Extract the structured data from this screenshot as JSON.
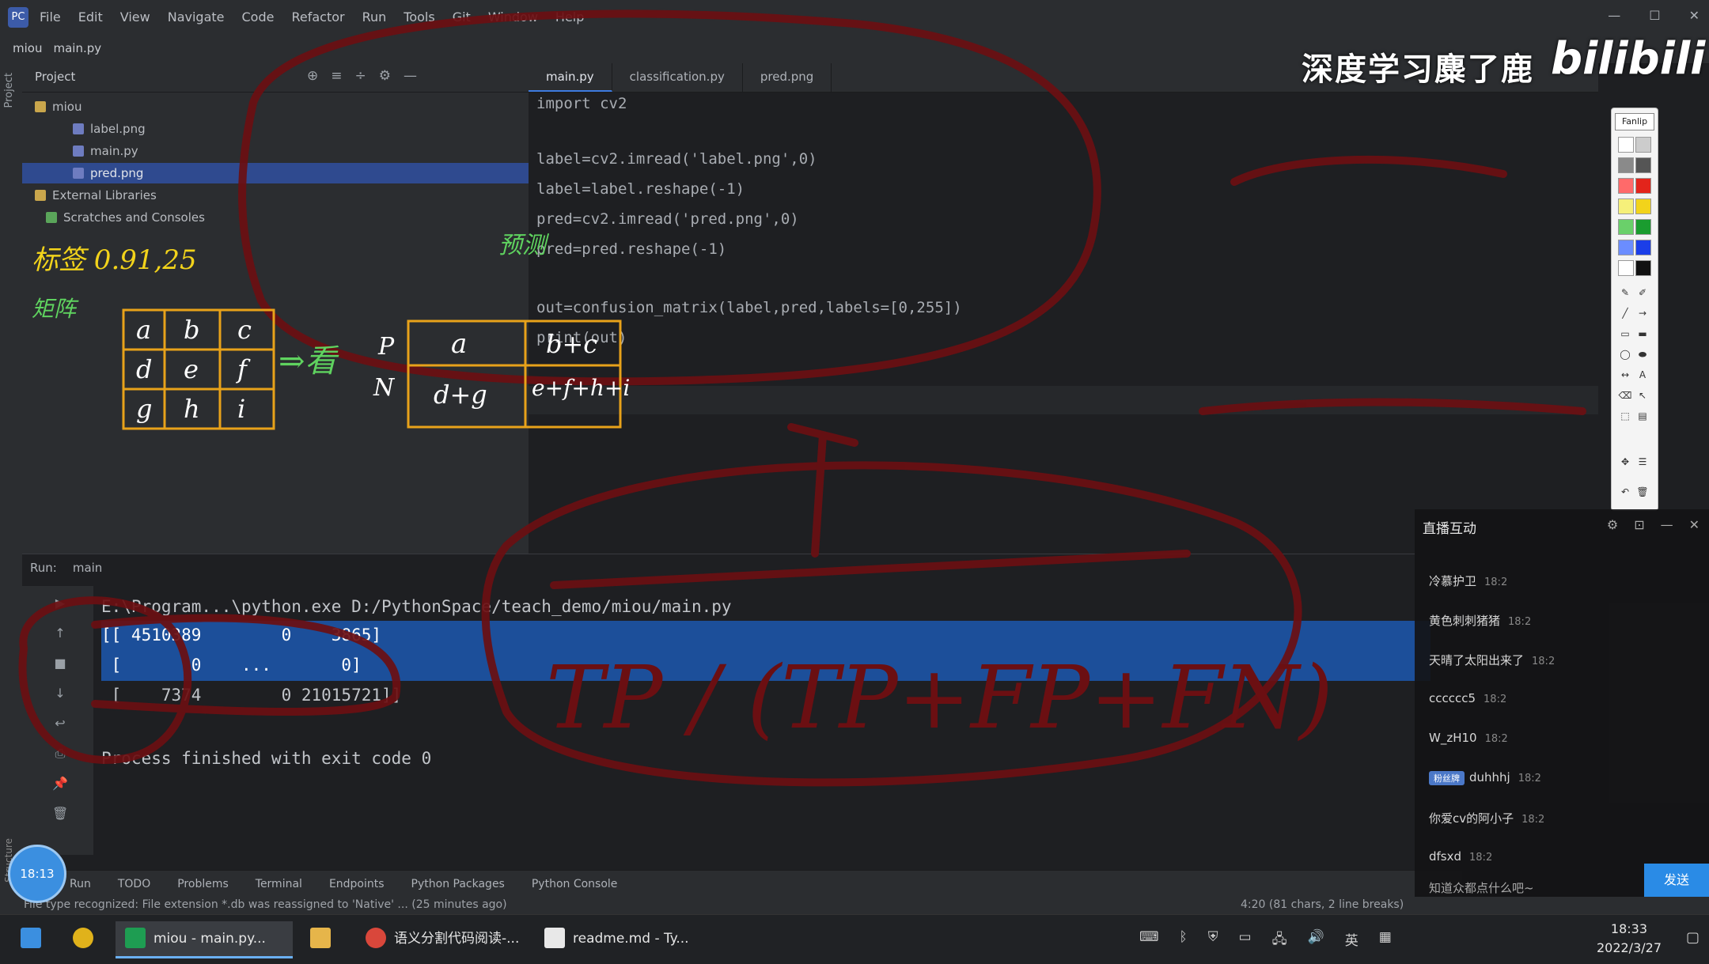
{
  "menubar": {
    "items": [
      "File",
      "Edit",
      "View",
      "Navigate",
      "Code",
      "Refactor",
      "Run",
      "Tools",
      "Git",
      "Window",
      "Help"
    ]
  },
  "navbar": {
    "project": "miou",
    "file": "main.py"
  },
  "leftstrip": {
    "project_label": "Project",
    "structure_label": "Structure"
  },
  "project_panel": {
    "title": "Project",
    "root": "miou",
    "files": [
      "label.png",
      "main.py",
      "pred.png"
    ],
    "external": "External Libraries",
    "scratches": "Scratches and Consoles"
  },
  "editor": {
    "tabs": [
      "main.py",
      "classification.py",
      "pred.png"
    ],
    "code": [
      "import cv2",
      "label=cv2.imread('label.png',0)",
      "label=label.reshape(-1)",
      "pred=cv2.imread('pred.png',0)",
      "pred=pred.reshape(-1)",
      "out=confusion_matrix(label,pred,labels=[0,255])",
      "print(out)"
    ]
  },
  "overlay": {
    "brand": "深度学习麋了鹿",
    "bili": "bilibili",
    "draw_header": "Fanlip"
  },
  "run_panel": {
    "tab_run": "Run:",
    "tab_name": "main",
    "command": "E:\\Program...\\python.exe D:/PythonSpace/teach_demo/miou/main.py",
    "matrix_rows": [
      "[[ 4510389        0    3865]",
      " [       0    ...       0]",
      " [    7374        0 21015721]]"
    ],
    "finished": "Process finished with exit code 0"
  },
  "bottom_tools": [
    "Run",
    "TODO",
    "Problems",
    "Terminal",
    "Endpoints",
    "Python Packages",
    "Python Console"
  ],
  "statusbar": {
    "message": "File type recognized: File extension *.db was reassigned to 'Native' ...",
    "ago": "(25 minutes ago)",
    "position": "4:20 (81 chars, 2 line breaks)"
  },
  "chat": {
    "header": "直播互动",
    "messages": [
      {
        "user": "冷慕护卫",
        "text": "18:2"
      },
      {
        "user": "黄色刺刺猪猪",
        "text": "18:2"
      },
      {
        "user": "天晴了太阳出来了",
        "text": "18:2"
      },
      {
        "user": "cccccc5",
        "text": "18:2"
      },
      {
        "user": "W_zH10",
        "text": "18:2"
      },
      {
        "user": "duhhhj",
        "text": "18:2",
        "badge": "粉丝牌"
      },
      {
        "user": "你爱cv的阿小子",
        "text": "18:2"
      },
      {
        "user": "dfsxd",
        "text": "18:2"
      },
      {
        "user": "知道众都点什么吧~",
        "text": ""
      }
    ],
    "send": "发送"
  },
  "avatar": {
    "label": "18:13"
  },
  "taskbar": {
    "items": [
      "miou - main.py...",
      "语义分割代码阅读-...",
      "readme.md - Ty..."
    ],
    "time": "18:33",
    "date": "2022/3/27",
    "ime": "英"
  },
  "annotations": {
    "label_stat": "标签 0.91,25",
    "predicted": "预测",
    "matrix_word": "矩阵",
    "mat_a": "a",
    "mat_b": "b",
    "mat_c": "c",
    "mat_d": "d",
    "mat_e": "e",
    "mat_f": "f",
    "mat_g": "g",
    "mat_h": "h",
    "mat_i": "i",
    "arrow_word": "⇒看",
    "p_label": "P",
    "n_label": "N",
    "cell_a": "a",
    "cell_bc": "b+c",
    "cell_dg": "d+g",
    "cell_efhi": "e+f+h+i",
    "big_note": "TP / (TP+FP+FN)"
  },
  "colors": {
    "ink": "#6b0f12",
    "green_ink": "#5fd35f",
    "orange_ink": "#e89a1c",
    "accent": "#3d7be0"
  }
}
